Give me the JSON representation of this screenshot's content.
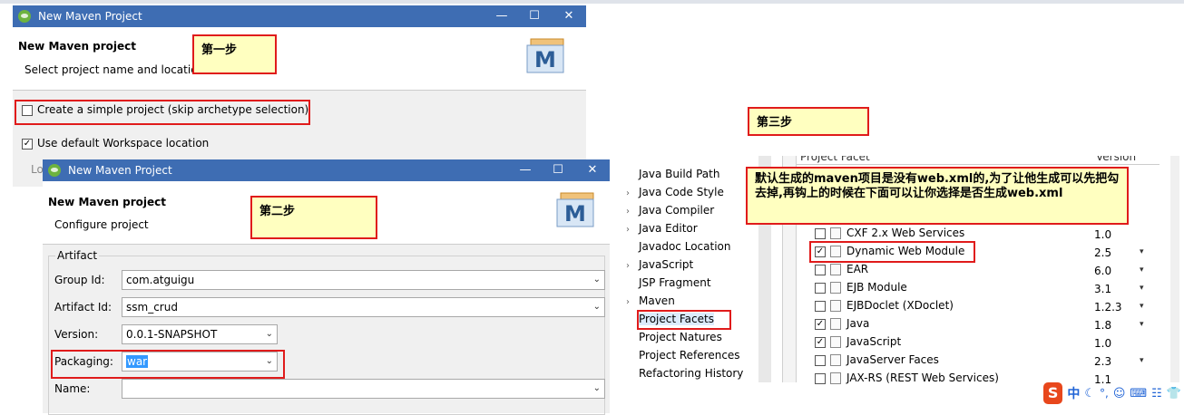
{
  "dialog1": {
    "window_title": "New Maven Project",
    "heading": "New Maven project",
    "subtitle": "Select project name and location",
    "simple_project_label": "Create a simple project (skip archetype selection)",
    "default_workspace_label": "Use default Workspace location",
    "location_label": "Lo",
    "maven_icon_letter": "M"
  },
  "dialog2": {
    "window_title": "New Maven Project",
    "heading": "New Maven project",
    "subtitle": "Configure project",
    "artifact_group": "Artifact",
    "group_id_label": "Group Id:",
    "group_id_value": "com.atguigu",
    "artifact_id_label": "Artifact Id:",
    "artifact_id_value": "ssm_crud",
    "version_label": "Version:",
    "version_value": "0.0.1-SNAPSHOT",
    "packaging_label": "Packaging:",
    "packaging_value": "war",
    "name_label": "Name:",
    "name_value": "",
    "maven_icon_letter": "M"
  },
  "notes": {
    "step1": "第一步",
    "step2": "第二步",
    "step3": "第三步",
    "facet_hint": "默认生成的maven项目是没有web.xml的,为了让他生成可以先把勾去掉,再钩上的时候在下面可以让你选择是否生成web.xml"
  },
  "properties_tree": [
    {
      "label": "Java Build Path",
      "arrow": ""
    },
    {
      "label": "Java Code Style",
      "arrow": "›"
    },
    {
      "label": "Java Compiler",
      "arrow": "›"
    },
    {
      "label": "Java Editor",
      "arrow": "›"
    },
    {
      "label": "Javadoc Location",
      "arrow": ""
    },
    {
      "label": "JavaScript",
      "arrow": "›"
    },
    {
      "label": "JSP Fragment",
      "arrow": ""
    },
    {
      "label": "Maven",
      "arrow": "›"
    },
    {
      "label": "Project Facets",
      "arrow": ""
    },
    {
      "label": "Project Natures",
      "arrow": ""
    },
    {
      "label": "Project References",
      "arrow": ""
    },
    {
      "label": "Refactoring History",
      "arrow": ""
    }
  ],
  "facets_header": {
    "facet": "Project Facet",
    "version": "Version"
  },
  "facets": [
    {
      "name": "CXF 2.x Web Services",
      "version": "1.0",
      "checked": false,
      "dropdown": false
    },
    {
      "name": "Dynamic Web Module",
      "version": "2.5",
      "checked": true,
      "dropdown": true
    },
    {
      "name": "EAR",
      "version": "6.0",
      "checked": false,
      "dropdown": true
    },
    {
      "name": "EJB Module",
      "version": "3.1",
      "checked": false,
      "dropdown": true
    },
    {
      "name": "EJBDoclet (XDoclet)",
      "version": "1.2.3",
      "checked": false,
      "dropdown": true
    },
    {
      "name": "Java",
      "version": "1.8",
      "checked": true,
      "dropdown": true
    },
    {
      "name": "JavaScript",
      "version": "1.0",
      "checked": true,
      "dropdown": false
    },
    {
      "name": "JavaServer Faces",
      "version": "2.3",
      "checked": false,
      "dropdown": true
    },
    {
      "name": "JAX-RS (REST Web Services)",
      "version": "1.1",
      "checked": false,
      "dropdown": false
    }
  ],
  "ime_bar": {
    "logo": "S",
    "lang": "中"
  },
  "colors": {
    "titlebar": "#3e6db3",
    "note_bg": "#ffffc0",
    "highlight": "#e01b1b",
    "selection": "#3399ff"
  }
}
